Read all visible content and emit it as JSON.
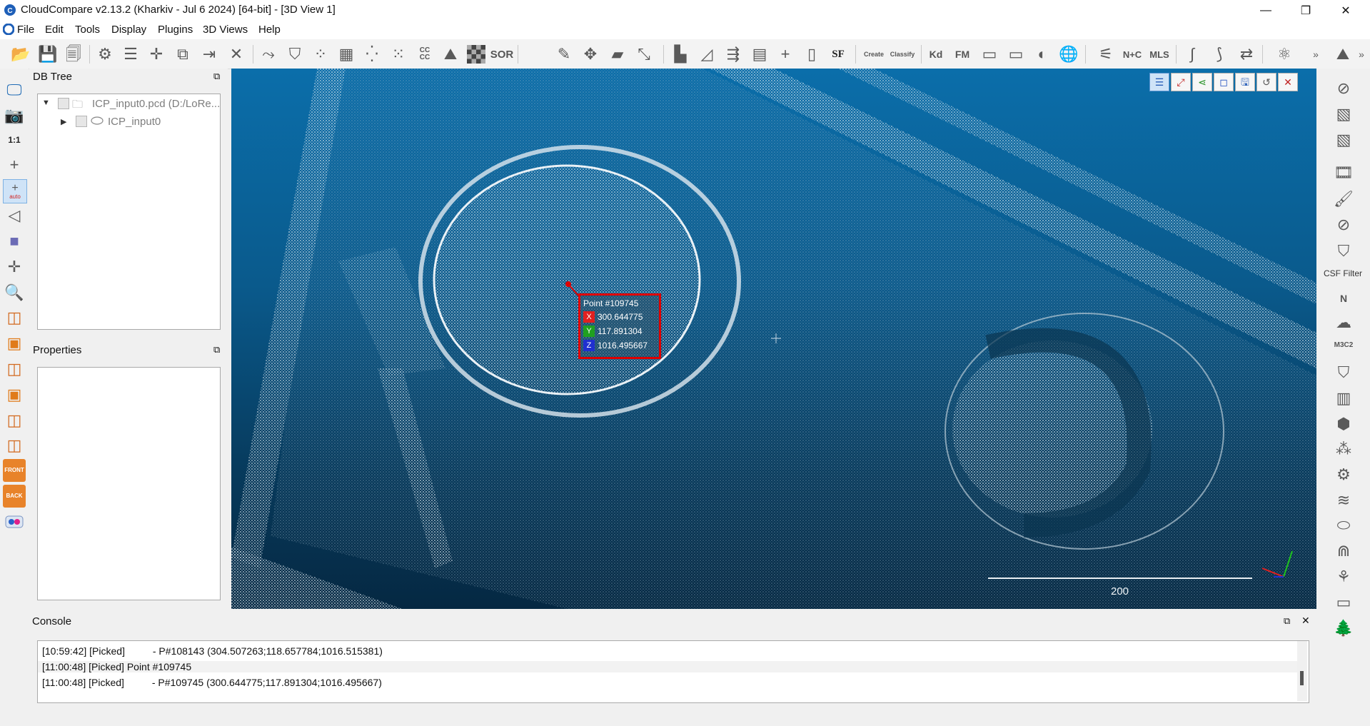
{
  "window": {
    "title": "CloudCompare v2.13.2 (Kharkiv - Jul  6 2024) [64-bit] - [3D View 1]",
    "minimize": "—",
    "restore": "❐",
    "close": "✕"
  },
  "menu": [
    "File",
    "Edit",
    "Tools",
    "Display",
    "Plugins",
    "3D Views",
    "Help"
  ],
  "toolbar": {
    "cc_label": "CC\nCC",
    "sor_label": "SOR",
    "sf_label": "SF",
    "canupo_create": "Create",
    "canupo_classify": "Classify",
    "kd_label": "Kd",
    "fm_label": "FM",
    "nc_label": "N+C",
    "mls_label": "MLS",
    "overflow": "»"
  },
  "left_toolbar": {
    "one_to_one": "1:1",
    "auto": "auto",
    "front": "FRONT",
    "back": "BACK"
  },
  "db_tree": {
    "title": "DB Tree",
    "items": [
      {
        "label": "ICP_input0.pcd (D:/LoRe..."
      },
      {
        "label": "ICP_input0"
      }
    ]
  },
  "properties": {
    "title": "Properties"
  },
  "view3d": {
    "point_label": {
      "title": "Point #109745",
      "x_axis": "X",
      "x_value": "300.644775",
      "y_axis": "Y",
      "y_value": "117.891304",
      "z_axis": "Z",
      "z_value": "1016.495667"
    },
    "scale_label": "200"
  },
  "right_toolbar": {
    "csf_filter": "CSF Filter",
    "n_label": "N",
    "m3c2_label": "M3C2"
  },
  "console": {
    "title": "Console",
    "lines": [
      "[10:59:42] [Picked]          - P#108143 (304.507263;118.657784;1016.515381)",
      "[11:00:48] [Picked] Point #109745",
      "[11:00:48] [Picked]          - P#109745 (300.644775;117.891304;1016.495667)"
    ]
  },
  "colors": {
    "accent": "#1e6fd9",
    "highlight": "#e00000",
    "x_axis": "#e02020",
    "y_axis": "#20a020",
    "z_axis": "#2030d0"
  }
}
